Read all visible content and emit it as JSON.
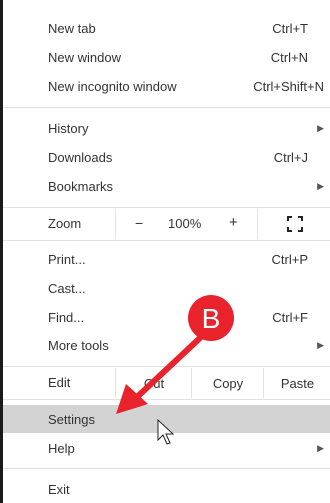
{
  "menu": {
    "new_tab": {
      "label": "New tab",
      "shortcut": "Ctrl+T"
    },
    "new_window": {
      "label": "New window",
      "shortcut": "Ctrl+N"
    },
    "new_incognito": {
      "label": "New incognito window",
      "shortcut": "Ctrl+Shift+N"
    },
    "history": {
      "label": "History"
    },
    "downloads": {
      "label": "Downloads",
      "shortcut": "Ctrl+J"
    },
    "bookmarks": {
      "label": "Bookmarks"
    },
    "zoom": {
      "label": "Zoom",
      "minus": "−",
      "level": "100%",
      "plus": "+"
    },
    "print": {
      "label": "Print...",
      "shortcut": "Ctrl+P"
    },
    "cast": {
      "label": "Cast..."
    },
    "find": {
      "label": "Find...",
      "shortcut": "Ctrl+F"
    },
    "more_tools": {
      "label": "More tools"
    },
    "edit": {
      "label": "Edit",
      "cut": "Cut",
      "copy": "Copy",
      "paste": "Paste"
    },
    "settings": {
      "label": "Settings"
    },
    "help": {
      "label": "Help"
    },
    "exit": {
      "label": "Exit"
    }
  },
  "annotation": {
    "letter": "B",
    "color": "#e8232b"
  },
  "icons": {
    "submenu": "chevron-right-icon",
    "fullscreen": "fullscreen-icon",
    "cursor": "cursor-arrow-icon"
  },
  "colors": {
    "highlight": "#d3d3d3",
    "text": "#333333",
    "separator": "#e2e2e2"
  }
}
